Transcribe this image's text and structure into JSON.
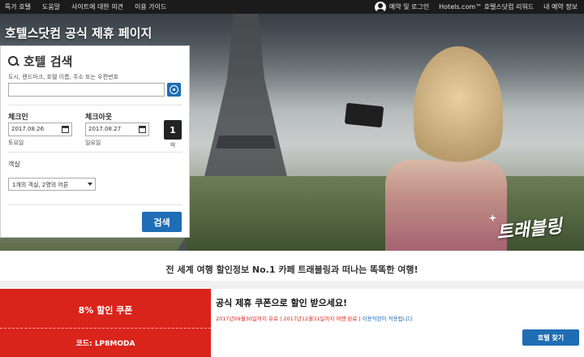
{
  "topnav": {
    "left_links": [
      "특가 호텔",
      "도움말",
      "사이트에 대한 의견",
      "이용 가이드"
    ],
    "login": "예약 및 로그인",
    "right_links": [
      "Hotels.com™ 호텔스닷컴 리워드",
      "내 예약 정보"
    ]
  },
  "hero": {
    "title": "호텔스닷컴 공식 제휴 페이지",
    "brand_logo": "트래블링"
  },
  "search_panel": {
    "heading": "호텔 검색",
    "destination_label": "도시, 랜드마크, 호텔 이름, 주소 또는 우편번호",
    "destination_value": "",
    "checkin_label": "체크인",
    "checkin_value": "2017.08.26",
    "checkin_day": "토요일",
    "checkout_label": "체크아웃",
    "checkout_value": "2017.08.27",
    "checkout_day": "일요일",
    "nights_value": "1",
    "nights_unit": "박",
    "rooms_label": "객실",
    "rooms_value": "1개의 객실, 2명의 어른",
    "search_button": "검색"
  },
  "tagline": "전 세계 여행 할인정보 No.1 카페 트래블링과 떠나는 똑똑한 여행!",
  "coupon": {
    "title": "8% 할인 쿠폰",
    "code": "코드: LP8MODA",
    "headline": "공식 제휴 쿠폰으로  할인 받으세요!",
    "terms_red": "2017년09월30일까지 유효 | 2017년12월31일까지 여행 완료 | ",
    "terms_blue": "이용약관이 적용됩니다",
    "find_button": "호텔 찾기"
  },
  "colors": {
    "brand_blue": "#1f6db4",
    "coupon_red": "#d9241b",
    "nav_dark": "#1b1b1b"
  }
}
